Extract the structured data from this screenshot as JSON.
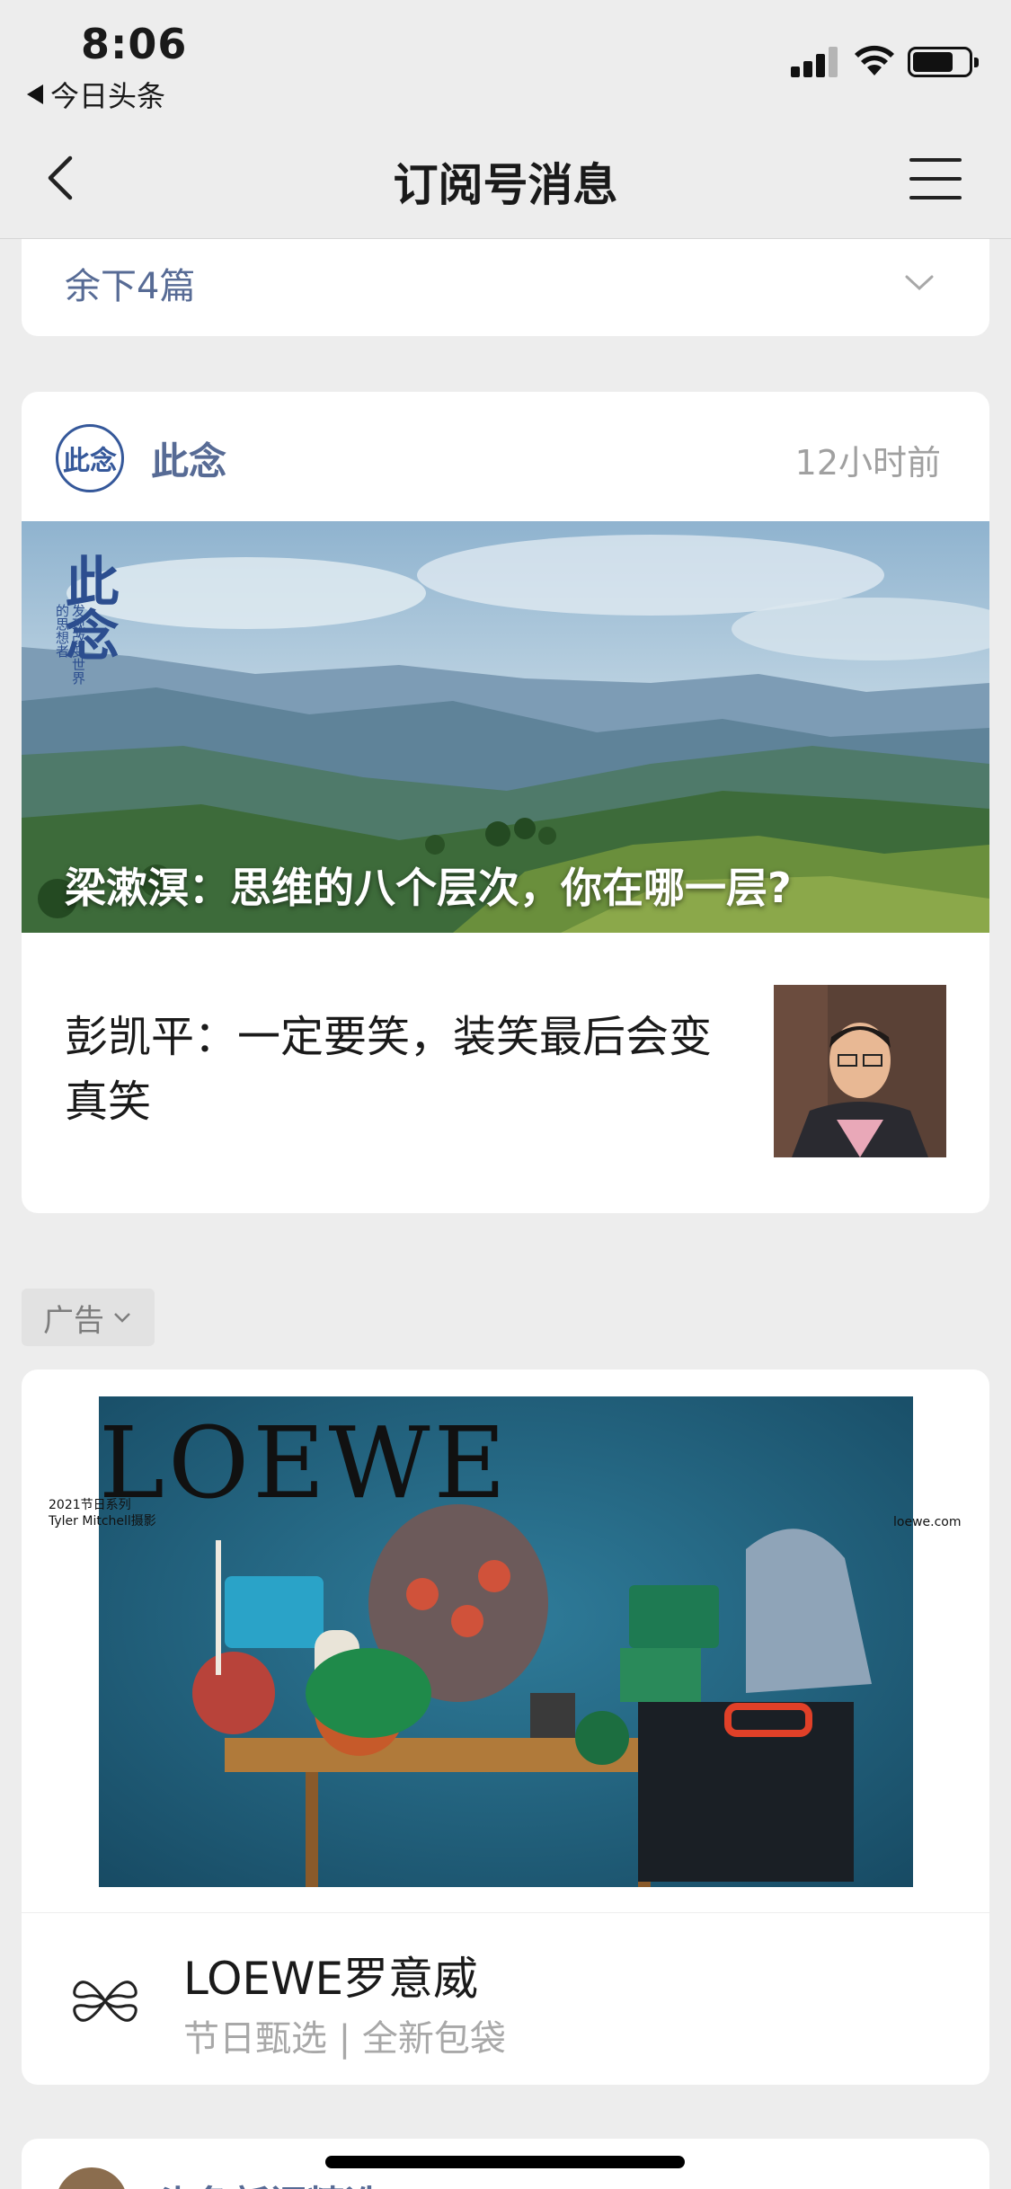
{
  "status_bar": {
    "time": "8:06",
    "back_app": "今日头条",
    "icons": [
      "signal-icon",
      "wifi-icon",
      "battery-icon"
    ]
  },
  "nav": {
    "title": "订阅号消息",
    "icons": [
      "back-chevron-icon",
      "menu-icon"
    ]
  },
  "top_card": {
    "more_label": "余下4篇",
    "icon": "chevron-down-icon"
  },
  "account_card": {
    "account_name": "此念",
    "logo_text": "此念",
    "time_ago": "12小时前",
    "hero_stamp_big": "此念",
    "hero_stamp_small": "发现改变世界的思想者",
    "hero_title": "梁漱溟：思维的八个层次，你在哪一层?",
    "sub_article_title": "彭凯平：一定要笑，装笑最后会变真笑"
  },
  "ad_tag": {
    "label": "广告"
  },
  "ad_card": {
    "banner_brand": "LOEWE",
    "banner_left_small_1": "2021节日系列",
    "banner_left_small_2": "Tyler Mitchell摄影",
    "banner_right_small": "loewe.com",
    "advertiser_name": "LOEWE罗意威",
    "advertiser_desc": "节日甄选 | 全新包袋"
  },
  "next_card": {
    "account_name": "头条新闻精选"
  },
  "colors": {
    "link_blue": "#576b95",
    "background": "#ededed",
    "card": "#ffffff",
    "muted": "#a0a0a0"
  }
}
